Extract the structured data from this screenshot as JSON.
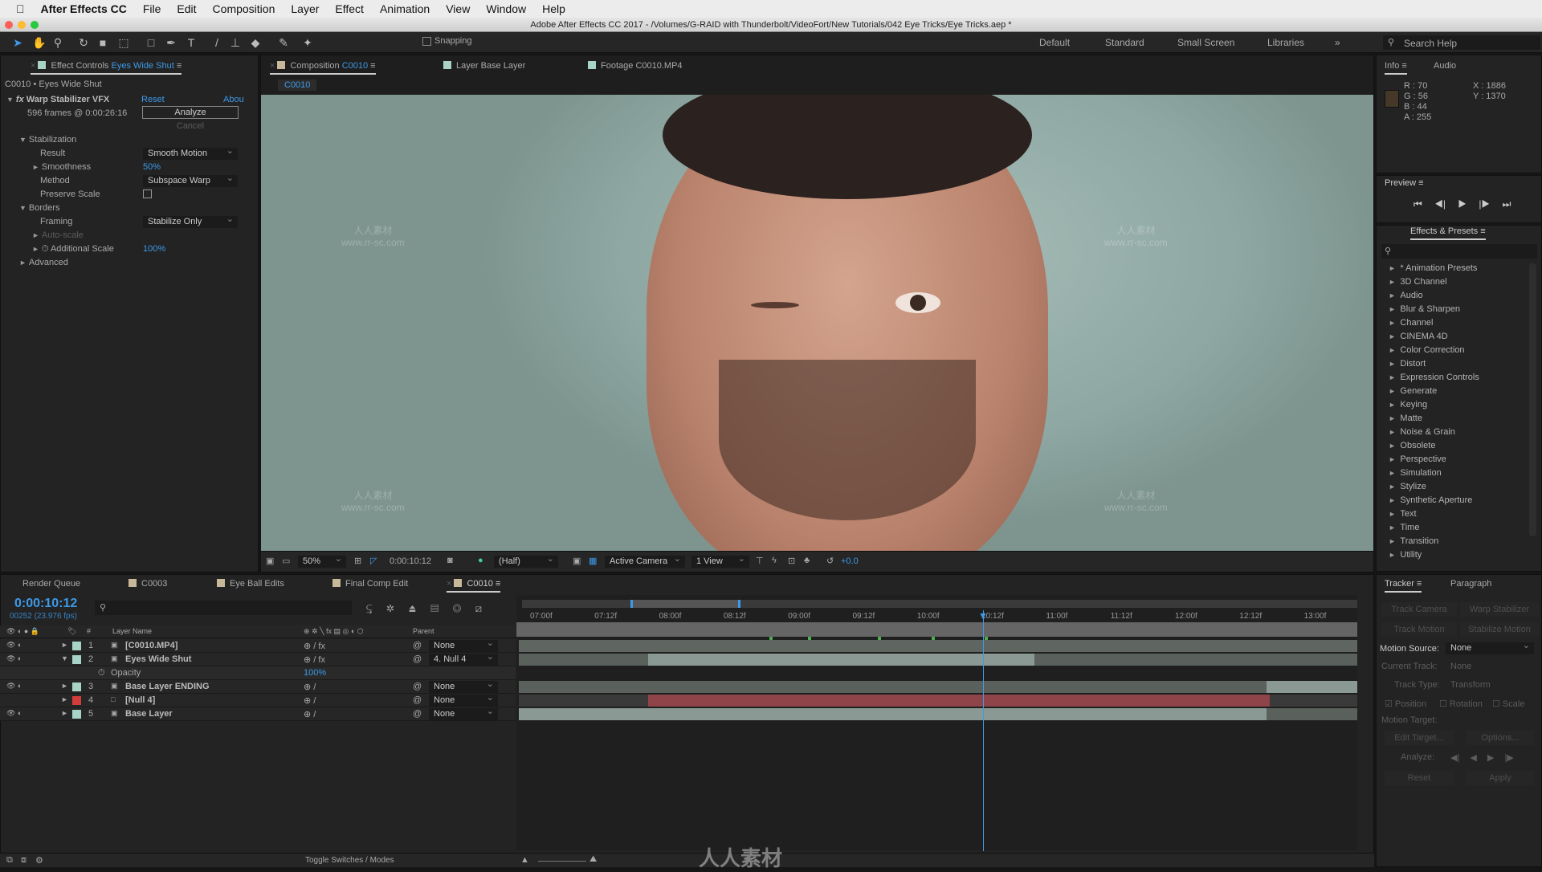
{
  "menubar": {
    "app": "After Effects CC",
    "items": [
      "File",
      "Edit",
      "Composition",
      "Layer",
      "Effect",
      "Animation",
      "View",
      "Window",
      "Help"
    ]
  },
  "titlebar": {
    "title": "Adobe After Effects CC 2017 - /Volumes/G-RAID with Thunderbolt/VideoFort/New Tutorials/042 Eye Tricks/Eye Tricks.aep *"
  },
  "toolbar": {
    "snapping": "Snapping",
    "workspaces": [
      "Default",
      "Standard",
      "Small Screen",
      "Libraries"
    ],
    "active_workspace": "Standard",
    "search_placeholder": "Search Help"
  },
  "effect_controls": {
    "tab_prefix": "Effect Controls",
    "tab_layer": "Eyes Wide Shut",
    "breadcrumb": "C0010 • Eyes Wide Shut",
    "effect_name": "Warp Stabilizer VFX",
    "reset": "Reset",
    "about": "Abou",
    "frames": "596 frames @ 0:00:26:16",
    "analyze": "Analyze",
    "cancel": "Cancel",
    "stabilization": "Stabilization",
    "result_label": "Result",
    "result_value": "Smooth Motion",
    "smoothness_label": "Smoothness",
    "smoothness_value": "50%",
    "method_label": "Method",
    "method_value": "Subspace Warp",
    "preserve_label": "Preserve Scale",
    "preserve_checked": false,
    "borders": "Borders",
    "framing_label": "Framing",
    "framing_value": "Stabilize Only",
    "autoscale": "Auto-scale",
    "additional_label": "Additional Scale",
    "additional_value": "100%",
    "advanced": "Advanced"
  },
  "viewer": {
    "tabs": [
      {
        "prefix": "Composition",
        "name": "C0010"
      },
      {
        "prefix": "Layer",
        "name": "Base Layer"
      },
      {
        "prefix": "Footage",
        "name": "C0010.MP4"
      }
    ],
    "subtab": "C0010",
    "watermark": "人人素材",
    "watermark_url": "www.rr-sc.com",
    "footer": {
      "zoom": "50%",
      "timecode": "0:00:10:12",
      "resolution": "(Half)",
      "camera": "Active Camera",
      "views": "1 View",
      "exposure": "+0.0"
    }
  },
  "info": {
    "tabs": [
      "Info",
      "Audio"
    ],
    "r": "R : 70",
    "g": "G : 56",
    "b": "B : 44",
    "a": "A : 255",
    "x": "X : 1886",
    "y": "Y : 1370",
    "swatch": "#463828"
  },
  "preview": {
    "title": "Preview"
  },
  "effects_presets": {
    "title": "Effects & Presets",
    "items": [
      "* Animation Presets",
      "3D Channel",
      "Audio",
      "Blur & Sharpen",
      "Channel",
      "CINEMA 4D",
      "Color Correction",
      "Distort",
      "Expression Controls",
      "Generate",
      "Keying",
      "Matte",
      "Noise & Grain",
      "Obsolete",
      "Perspective",
      "Simulation",
      "Stylize",
      "Synthetic Aperture",
      "Text",
      "Time",
      "Transition",
      "Utility"
    ]
  },
  "timeline": {
    "tabs": [
      "Render Queue",
      "C0003",
      "Eye Ball Edits",
      "Final Comp Edit",
      "C0010"
    ],
    "active_tab": "C0010",
    "timecode": "0:00:10:12",
    "fps": "00252 (23.976 fps)",
    "header": {
      "num": "#",
      "layer_name": "Layer Name",
      "parent": "Parent"
    },
    "layers": [
      {
        "num": "1",
        "name": "[C0010.MP4]",
        "color": "#a8d4c8",
        "parent": "None",
        "fx": true,
        "expanded": false
      },
      {
        "num": "2",
        "name": "Eyes Wide Shut",
        "color": "#a8d4c8",
        "parent": "4. Null 4",
        "fx": true,
        "expanded": true
      },
      {
        "num": "3",
        "name": "Base Layer  ENDING",
        "color": "#a8d4c8",
        "parent": "None",
        "fx": false,
        "expanded": false
      },
      {
        "num": "4",
        "name": "[Null 4]",
        "color": "#d23c3c",
        "parent": "None",
        "fx": false,
        "expanded": false
      },
      {
        "num": "5",
        "name": "Base Layer",
        "color": "#a8d4c8",
        "parent": "None",
        "fx": false,
        "expanded": false
      }
    ],
    "opacity_label": "Opacity",
    "opacity_value": "100%",
    "ruler": [
      "07:00f",
      "07:12f",
      "08:00f",
      "08:12f",
      "09:00f",
      "09:12f",
      "10:00f",
      "10:12f",
      "11:00f",
      "11:12f",
      "12:00f",
      "12:12f",
      "13:00f"
    ],
    "toggle": "Toggle Switches / Modes"
  },
  "tracker": {
    "tabs": [
      "Tracker",
      "Paragraph"
    ],
    "track_camera": "Track Camera",
    "warp_stabilizer": "Warp Stabilizer",
    "track_motion": "Track Motion",
    "stabilize_motion": "Stabilize Motion",
    "motion_source_label": "Motion Source:",
    "motion_source": "None",
    "current_track_label": "Current Track:",
    "current_track": "None",
    "track_type_label": "Track Type:",
    "track_type": "Transform",
    "position": "Position",
    "rotation": "Rotation",
    "scale": "Scale",
    "motion_target": "Motion Target:",
    "edit_target": "Edit Target...",
    "options": "Options...",
    "analyze": "Analyze:",
    "reset": "Reset",
    "apply": "Apply"
  },
  "bottom_logo": "人人素材"
}
